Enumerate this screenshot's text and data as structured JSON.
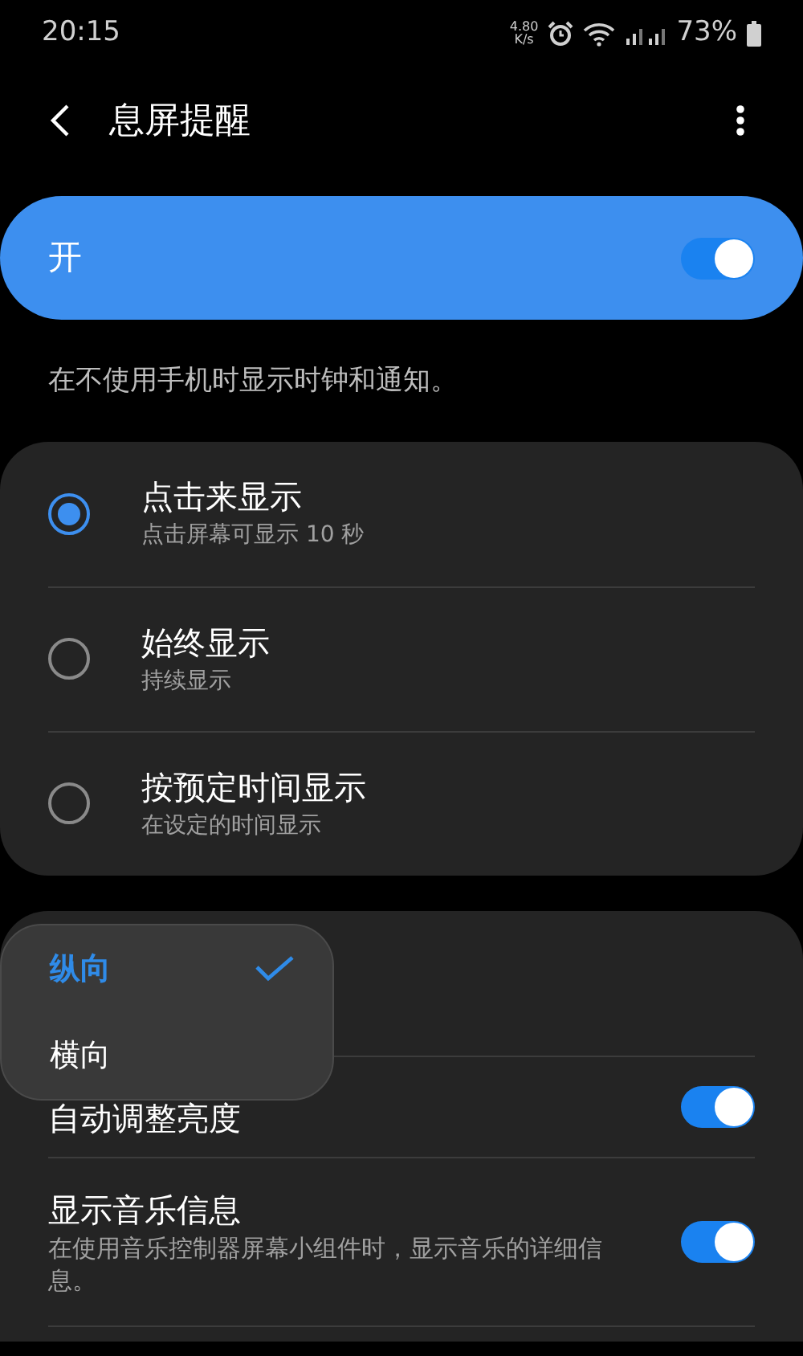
{
  "status_bar": {
    "time": "20:15",
    "speed": "4.80",
    "speed_unit": "K/s",
    "battery": "73%"
  },
  "header": {
    "title": "息屏提醒"
  },
  "master": {
    "label": "开",
    "on": true
  },
  "description": "在不使用手机时显示时钟和通知。",
  "modes": [
    {
      "title": "点击来显示",
      "subtitle": "点击屏幕可显示 10 秒",
      "selected": true
    },
    {
      "title": "始终显示",
      "subtitle": "持续显示",
      "selected": false
    },
    {
      "title": "按预定时间显示",
      "subtitle": "在设定的时间显示",
      "selected": false
    }
  ],
  "settings": [
    {
      "title": "自动调整亮度",
      "on": true
    },
    {
      "title": "显示音乐信息",
      "subtitle": "在使用音乐控制器屏幕小组件时，显示音乐的详细信息。",
      "on": true
    }
  ],
  "orientation_menu": [
    {
      "label": "纵向",
      "selected": true
    },
    {
      "label": "横向",
      "selected": false
    }
  ]
}
